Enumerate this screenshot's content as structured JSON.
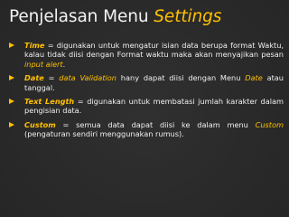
{
  "title": {
    "plain": "Penjelasan Menu ",
    "emph": "Settings"
  },
  "items": [
    {
      "term": "Time",
      "parts": [
        {
          "t": " = digunakan untuk mengatur isian data berupa format Waktu, kalau tidak diisi dengan Format waktu maka akan menyajikan pesan ",
          "i": false
        },
        {
          "t": "input alert",
          "i": true
        },
        {
          "t": ".",
          "i": false
        }
      ]
    },
    {
      "term": "Date",
      "parts": [
        {
          "t": " = ",
          "i": false
        },
        {
          "t": "data Validation",
          "i": true
        },
        {
          "t": " hany dapat diisi dengan Menu ",
          "i": false
        },
        {
          "t": "Date",
          "i": true
        },
        {
          "t": " atau tanggal.",
          "i": false
        }
      ]
    },
    {
      "term": "Text Length",
      "parts": [
        {
          "t": " = digunakan untuk membatasi jumlah karakter dalam pengisian data.",
          "i": false
        }
      ]
    },
    {
      "term": "Custom",
      "parts": [
        {
          "t": " = semua data dapat diisi ke dalam menu ",
          "i": false
        },
        {
          "t": "Custom",
          "i": true
        },
        {
          "t": " (pengaturan sendiri menggunakan rumus).",
          "i": false
        }
      ]
    }
  ],
  "colors": {
    "accent": "#ffc000",
    "text": "#f0f0f0",
    "background": "#2a2a2a"
  }
}
